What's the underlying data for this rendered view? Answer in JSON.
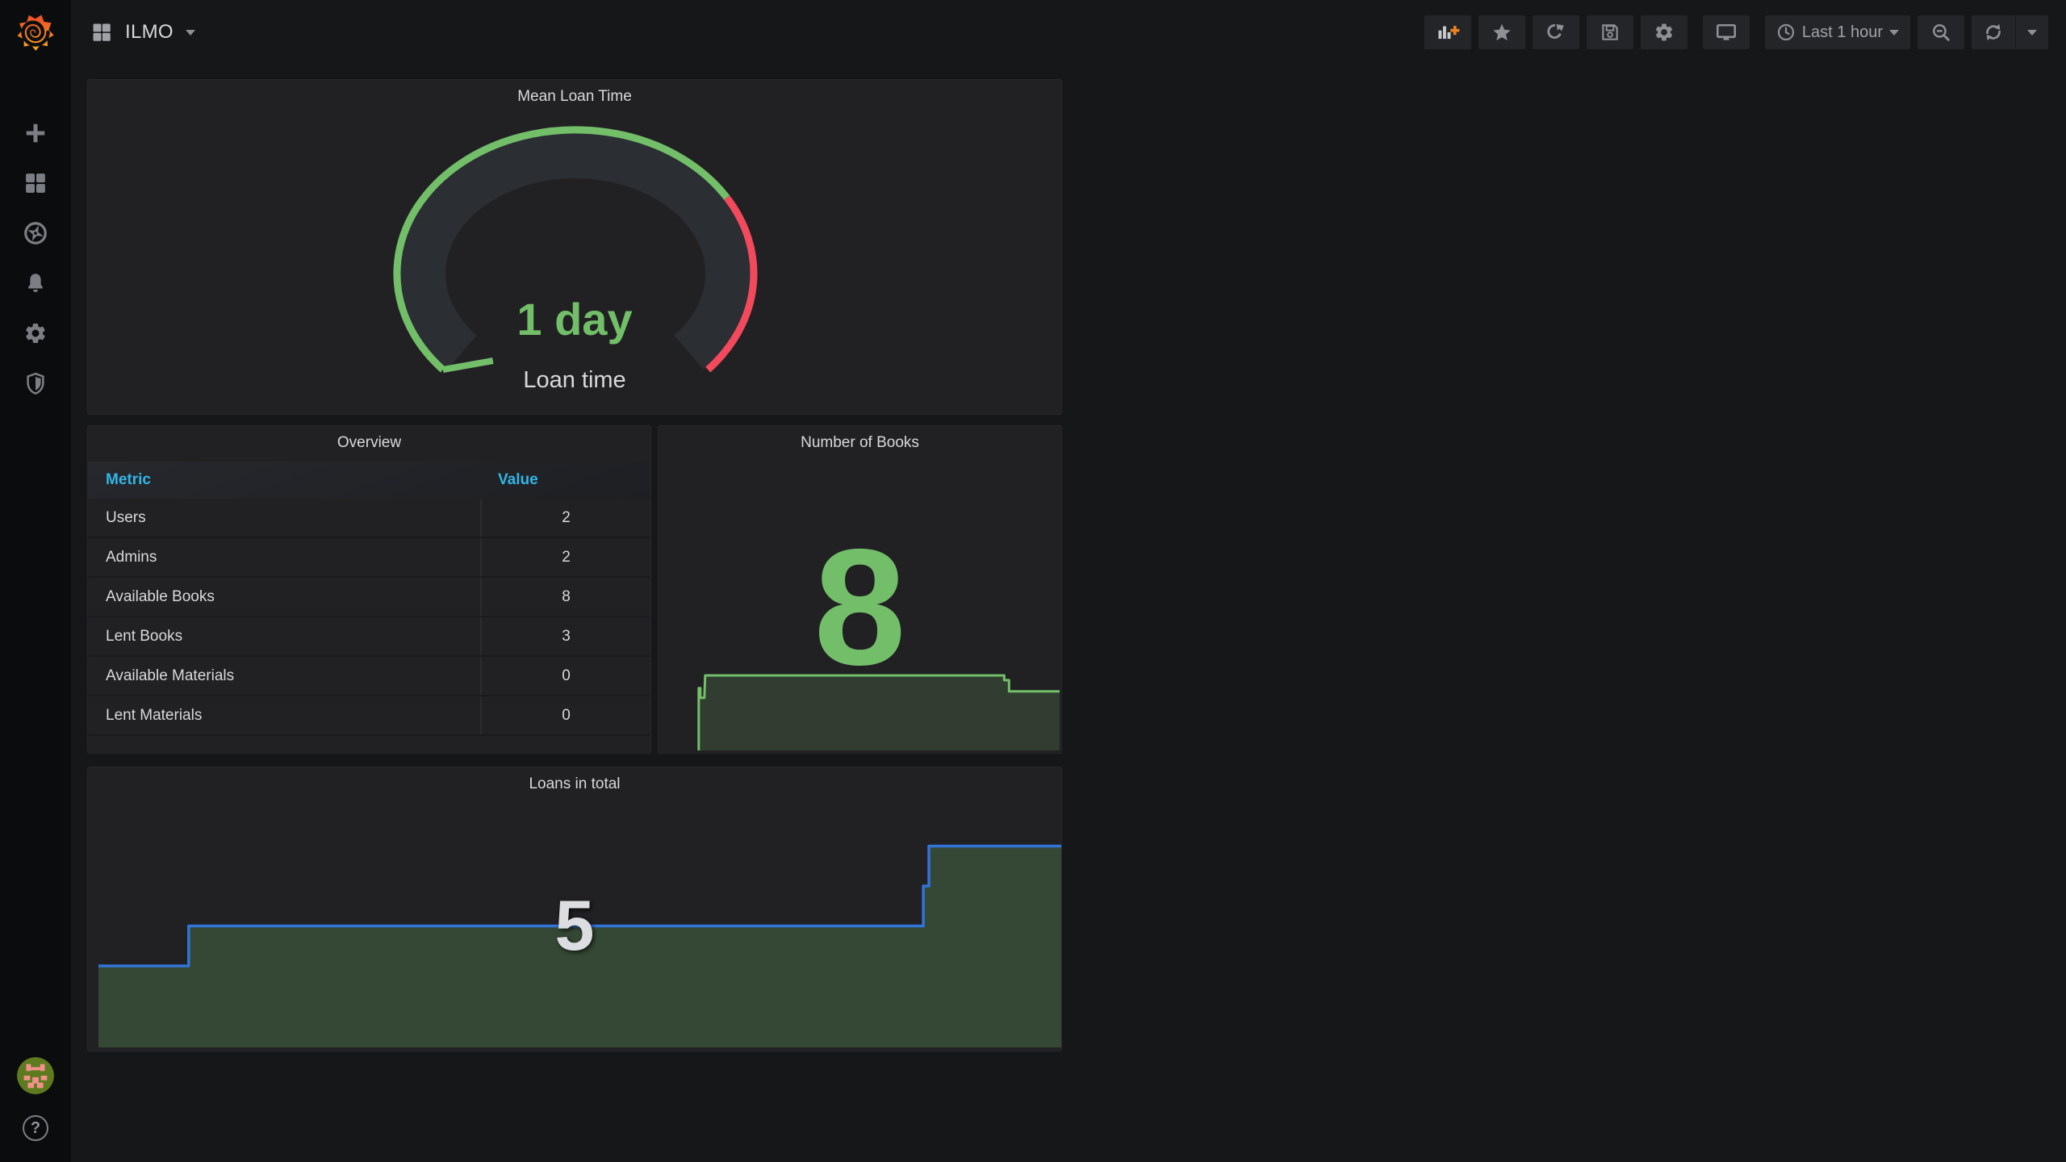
{
  "app": "Grafana",
  "navbar": {
    "title": "ILMO",
    "time_range": "Last 1 hour",
    "actions": [
      "add-panel",
      "mark-as-favorite",
      "share-dashboard",
      "save-dashboard",
      "dashboard-settings",
      "cycle-view-mode",
      "time-picker",
      "zoom-out-time-range",
      "refresh-dashboard",
      "refresh-interval-picker"
    ]
  },
  "sidebar": {
    "items": [
      "create",
      "dashboards",
      "explore",
      "alerting",
      "configuration",
      "server-admin"
    ],
    "help_label": "?"
  },
  "colors": {
    "green": "#73bf69",
    "red": "#f2495c",
    "blue_line": "#3274d9",
    "header_blue": "#33b5e5",
    "panel_bg": "#212124",
    "page_bg": "#161719",
    "text": "#d8d9da",
    "orange_plus": "#eb8220"
  },
  "panels": {
    "gauge": {
      "title": "Mean Loan Time",
      "value": "1 day",
      "label": "Loan time"
    },
    "overview": {
      "title": "Overview",
      "columns": [
        "Metric",
        "Value"
      ],
      "rows": [
        [
          "Users",
          "2"
        ],
        [
          "Admins",
          "2"
        ],
        [
          "Available Books",
          "8"
        ],
        [
          "Lent Books",
          "3"
        ],
        [
          "Available Materials",
          "0"
        ],
        [
          "Lent Materials",
          "0"
        ]
      ]
    },
    "books": {
      "title": "Number of Books",
      "value": "8"
    },
    "loans": {
      "title": "Loans in total",
      "value": "5"
    }
  },
  "chart_data": [
    {
      "type": "gauge",
      "title": "Mean Loan Time",
      "value_text": "1 day",
      "metric_label": "Loan time",
      "percent_green": 0.72,
      "colors": {
        "ok": "#73bf69",
        "alert": "#f2495c",
        "band": "#2b2e33"
      }
    },
    {
      "type": "table",
      "title": "Overview",
      "columns": [
        "Metric",
        "Value"
      ],
      "rows": [
        [
          "Users",
          2
        ],
        [
          "Admins",
          2
        ],
        [
          "Available Books",
          8
        ],
        [
          "Lent Books",
          3
        ],
        [
          "Available Materials",
          0
        ],
        [
          "Lent Materials",
          0
        ]
      ]
    },
    {
      "type": "area",
      "title": "Number of Books",
      "current": 8,
      "ylim": [
        3.3,
        8
      ],
      "line_color": "#73bf69",
      "fill_color": "rgba(115,191,105,0.18)",
      "points": [
        [
          0.0998,
          3.3
        ],
        [
          0.0998,
          7.2
        ],
        [
          0.1038,
          7.2
        ],
        [
          0.1038,
          6.6
        ],
        [
          0.1138,
          6.6
        ],
        [
          0.1158,
          8
        ],
        [
          0.8583,
          8
        ],
        [
          0.8583,
          7.7
        ],
        [
          0.8703,
          7.7
        ],
        [
          0.8703,
          7
        ],
        [
          0.996,
          7
        ]
      ]
    },
    {
      "type": "area",
      "title": "Loans in total",
      "current": 5,
      "ylim": [
        2,
        8
      ],
      "line_color": "#3274d9",
      "fill_color": "rgba(115,191,105,0.25)",
      "points": [
        [
          0.0108,
          4
        ],
        [
          0.1035,
          4
        ],
        [
          0.1035,
          5
        ],
        [
          0.8583,
          5
        ],
        [
          0.8583,
          6
        ],
        [
          0.864,
          6
        ],
        [
          0.864,
          7
        ],
        [
          1,
          7
        ]
      ]
    }
  ]
}
